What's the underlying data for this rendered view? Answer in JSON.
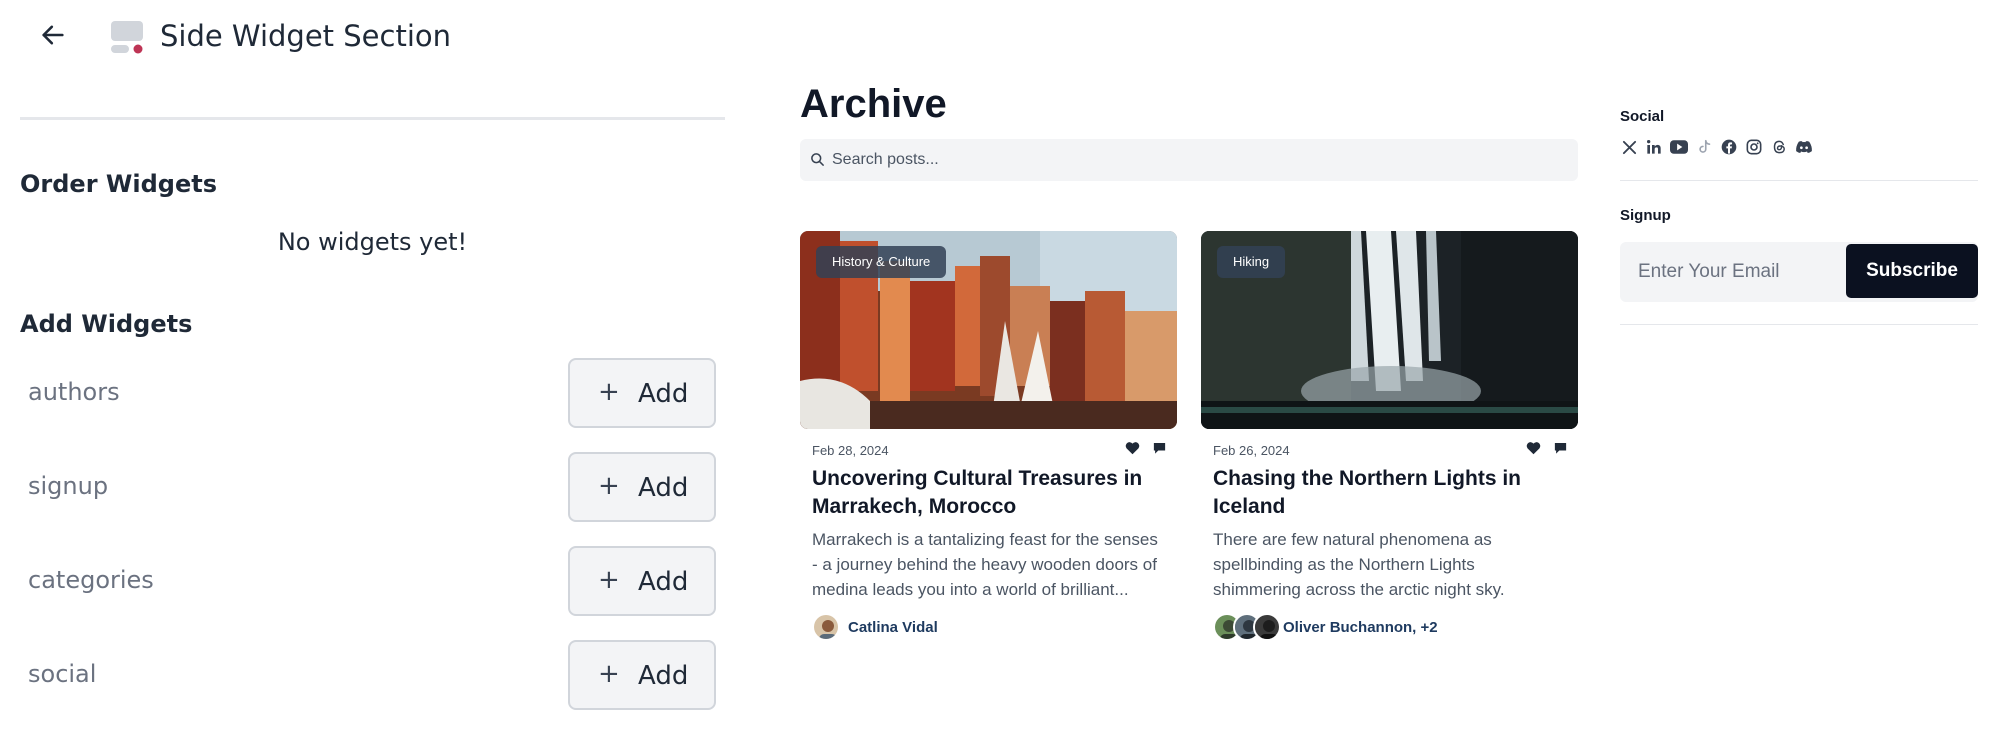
{
  "editor": {
    "title": "Side Widget Section",
    "order_heading": "Order Widgets",
    "empty_message": "No widgets yet!",
    "add_heading": "Add Widgets",
    "add_label": "Add",
    "widgets": [
      {
        "name": "authors"
      },
      {
        "name": "signup"
      },
      {
        "name": "categories"
      },
      {
        "name": "social"
      }
    ]
  },
  "preview": {
    "title": "Archive",
    "search": {
      "placeholder": "Search posts..."
    },
    "posts": [
      {
        "category": "History & Culture",
        "date": "Feb 28, 2024",
        "title": "Uncovering Cultural Treasures in Marrakech, Morocco",
        "excerpt": "Marrakech is a tantalizing feast for the senses - a journey behind the heavy wooden doors of medina leads you into a world of brilliant...",
        "author": "Catlina Vidal"
      },
      {
        "category": "Hiking",
        "date": "Feb 26, 2024",
        "title": "Chasing the Northern Lights in Iceland",
        "excerpt": "There are few natural phenomena as spellbinding as the Northern Lights shimmering across the arctic night sky.",
        "author": "Oliver Buchannon, +2"
      }
    ],
    "sidebar": {
      "social_label": "Social",
      "social_icons": [
        "x-icon",
        "linkedin-icon",
        "youtube-icon",
        "tiktok-icon",
        "facebook-icon",
        "instagram-icon",
        "threads-icon",
        "discord-icon"
      ],
      "signup_label": "Signup",
      "email_placeholder": "Enter Your Email",
      "subscribe_label": "Subscribe"
    }
  },
  "colors": {
    "accent_dark": "#0b1120",
    "author_link": "#1e3a5f",
    "section_icon_dot": "#be3455"
  }
}
